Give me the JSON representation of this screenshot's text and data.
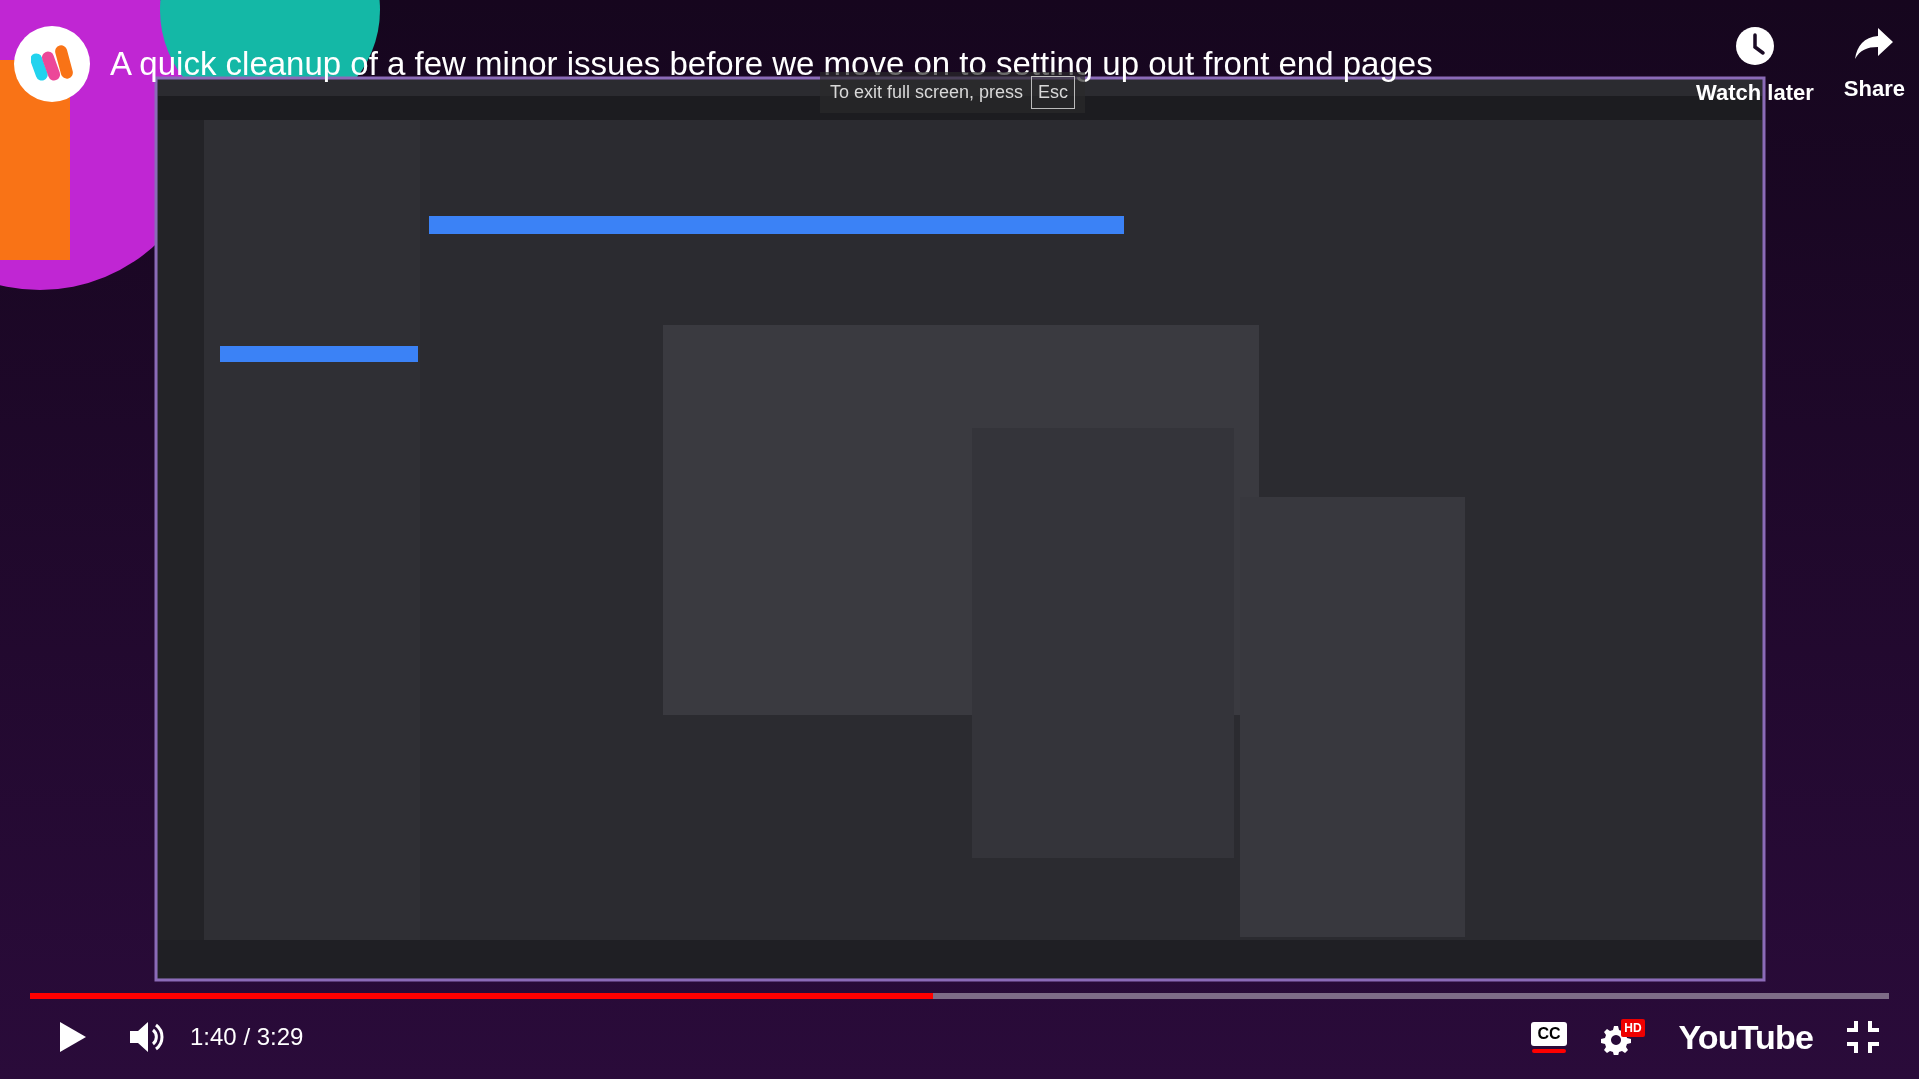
{
  "player": {
    "title": "A quick cleanup of a few minor issues before we move on to setting up out front end pages",
    "toast": {
      "text": "To exit full screen, press",
      "key": "Esc"
    },
    "actions": [
      {
        "label": "Watch later",
        "kind": "clock"
      },
      {
        "label": "Share",
        "kind": "share"
      }
    ],
    "progress": {
      "level": 0.486
    },
    "time": "1:40 / 3:29",
    "captions": {
      "label": "CC",
      "on": true
    },
    "quality_badge": "HD",
    "logo": "YouTube"
  }
}
